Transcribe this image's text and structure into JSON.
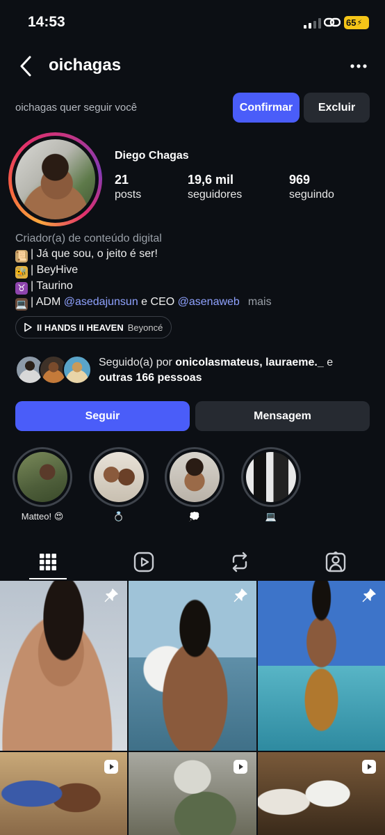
{
  "status_bar": {
    "time": "14:53",
    "battery": "65"
  },
  "header": {
    "username": "oichagas"
  },
  "follow_request": {
    "text": "oichagas quer seguir você",
    "confirm_label": "Confirmar",
    "delete_label": "Excluir"
  },
  "profile": {
    "full_name": "Diego Chagas",
    "stats": [
      {
        "value": "21",
        "label": "posts"
      },
      {
        "value": "19,6 mil",
        "label": "seguidores"
      },
      {
        "value": "969",
        "label": "seguindo"
      }
    ]
  },
  "bio": {
    "category": "Criador(a) de conteúdo digital",
    "line1": "| Já que sou, o jeito é ser!",
    "line2": "| BeyHive",
    "line3": "| Taurino",
    "line4_prefix": "| ADM",
    "mention1": "@asedajunsun",
    "line4_mid": "e CEO",
    "mention2": "@asenaweb",
    "more": "mais"
  },
  "music": {
    "song": "II HANDS II HEAVEN",
    "artist": "Beyoncé"
  },
  "followed_by": {
    "prefix": "Seguido(a) por",
    "names": "onicolasmateus, lauraeme._",
    "connector": "e",
    "others": "outras 166 pessoas"
  },
  "actions": {
    "follow_label": "Seguir",
    "message_label": "Mensagem"
  },
  "highlights": [
    {
      "label": "Matteo! 😍"
    },
    {
      "label": "💍"
    },
    {
      "label": "💭"
    },
    {
      "label": "💻"
    }
  ],
  "icons": {
    "back": "chevron-left-icon",
    "more": "more-horizontal-icon",
    "grid": "grid-icon",
    "reels": "reels-icon",
    "reposts": "repost-icon",
    "tagged": "tagged-icon",
    "pin": "pin-icon",
    "video": "video-icon",
    "music": "play-icon"
  },
  "colors": {
    "accent": "#4a5df9",
    "background": "#0c0f14",
    "secondary_button": "#262a31",
    "mention": "#8fa2ff"
  }
}
